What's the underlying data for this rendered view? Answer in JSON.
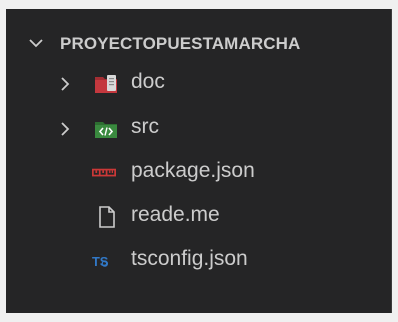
{
  "explorer": {
    "section_title": "PROYECTOPUESTAMARCHA",
    "items": [
      {
        "label": "doc",
        "kind": "folder",
        "icon": "doc-folder-icon",
        "expanded": false
      },
      {
        "label": "src",
        "kind": "folder",
        "icon": "src-folder-icon",
        "expanded": false
      },
      {
        "label": "package.json",
        "kind": "file",
        "icon": "npm-icon"
      },
      {
        "label": "reade.me",
        "kind": "file",
        "icon": "file-icon"
      },
      {
        "label": "tsconfig.json",
        "kind": "file",
        "icon": "typescript-config-icon"
      }
    ]
  },
  "colors": {
    "panel_background": "#252526",
    "text": "#cccccc",
    "doc_folder": "#c4383e",
    "src_folder": "#3a8a3f",
    "npm": "#cb3837",
    "typescript": "#3178c6"
  }
}
